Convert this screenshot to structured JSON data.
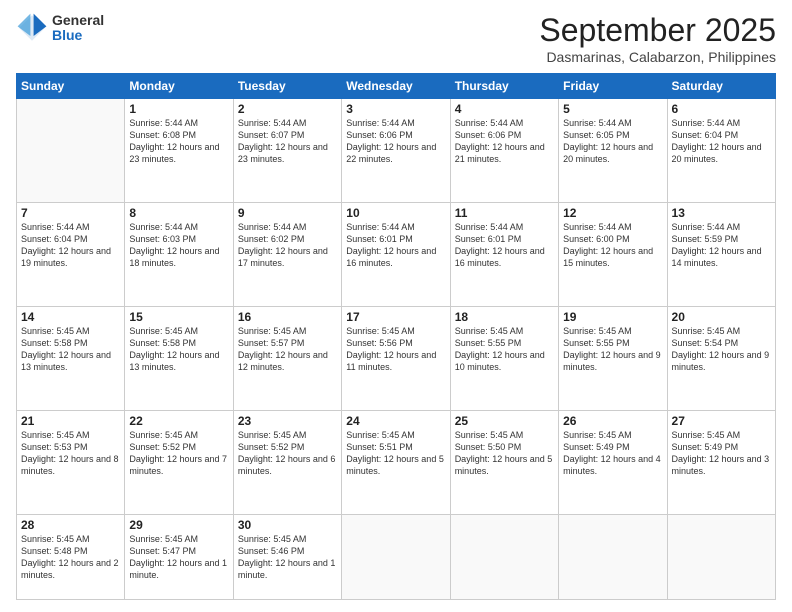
{
  "logo": {
    "general": "General",
    "blue": "Blue"
  },
  "header": {
    "month": "September 2025",
    "location": "Dasmarinas, Calabarzon, Philippines"
  },
  "days_of_week": [
    "Sunday",
    "Monday",
    "Tuesday",
    "Wednesday",
    "Thursday",
    "Friday",
    "Saturday"
  ],
  "weeks": [
    [
      {
        "day": "",
        "info": ""
      },
      {
        "day": "1",
        "info": "Sunrise: 5:44 AM\nSunset: 6:08 PM\nDaylight: 12 hours\nand 23 minutes."
      },
      {
        "day": "2",
        "info": "Sunrise: 5:44 AM\nSunset: 6:07 PM\nDaylight: 12 hours\nand 23 minutes."
      },
      {
        "day": "3",
        "info": "Sunrise: 5:44 AM\nSunset: 6:06 PM\nDaylight: 12 hours\nand 22 minutes."
      },
      {
        "day": "4",
        "info": "Sunrise: 5:44 AM\nSunset: 6:06 PM\nDaylight: 12 hours\nand 21 minutes."
      },
      {
        "day": "5",
        "info": "Sunrise: 5:44 AM\nSunset: 6:05 PM\nDaylight: 12 hours\nand 20 minutes."
      },
      {
        "day": "6",
        "info": "Sunrise: 5:44 AM\nSunset: 6:04 PM\nDaylight: 12 hours\nand 20 minutes."
      }
    ],
    [
      {
        "day": "7",
        "info": "Sunrise: 5:44 AM\nSunset: 6:04 PM\nDaylight: 12 hours\nand 19 minutes."
      },
      {
        "day": "8",
        "info": "Sunrise: 5:44 AM\nSunset: 6:03 PM\nDaylight: 12 hours\nand 18 minutes."
      },
      {
        "day": "9",
        "info": "Sunrise: 5:44 AM\nSunset: 6:02 PM\nDaylight: 12 hours\nand 17 minutes."
      },
      {
        "day": "10",
        "info": "Sunrise: 5:44 AM\nSunset: 6:01 PM\nDaylight: 12 hours\nand 16 minutes."
      },
      {
        "day": "11",
        "info": "Sunrise: 5:44 AM\nSunset: 6:01 PM\nDaylight: 12 hours\nand 16 minutes."
      },
      {
        "day": "12",
        "info": "Sunrise: 5:44 AM\nSunset: 6:00 PM\nDaylight: 12 hours\nand 15 minutes."
      },
      {
        "day": "13",
        "info": "Sunrise: 5:44 AM\nSunset: 5:59 PM\nDaylight: 12 hours\nand 14 minutes."
      }
    ],
    [
      {
        "day": "14",
        "info": "Sunrise: 5:45 AM\nSunset: 5:58 PM\nDaylight: 12 hours\nand 13 minutes."
      },
      {
        "day": "15",
        "info": "Sunrise: 5:45 AM\nSunset: 5:58 PM\nDaylight: 12 hours\nand 13 minutes."
      },
      {
        "day": "16",
        "info": "Sunrise: 5:45 AM\nSunset: 5:57 PM\nDaylight: 12 hours\nand 12 minutes."
      },
      {
        "day": "17",
        "info": "Sunrise: 5:45 AM\nSunset: 5:56 PM\nDaylight: 12 hours\nand 11 minutes."
      },
      {
        "day": "18",
        "info": "Sunrise: 5:45 AM\nSunset: 5:55 PM\nDaylight: 12 hours\nand 10 minutes."
      },
      {
        "day": "19",
        "info": "Sunrise: 5:45 AM\nSunset: 5:55 PM\nDaylight: 12 hours\nand 9 minutes."
      },
      {
        "day": "20",
        "info": "Sunrise: 5:45 AM\nSunset: 5:54 PM\nDaylight: 12 hours\nand 9 minutes."
      }
    ],
    [
      {
        "day": "21",
        "info": "Sunrise: 5:45 AM\nSunset: 5:53 PM\nDaylight: 12 hours\nand 8 minutes."
      },
      {
        "day": "22",
        "info": "Sunrise: 5:45 AM\nSunset: 5:52 PM\nDaylight: 12 hours\nand 7 minutes."
      },
      {
        "day": "23",
        "info": "Sunrise: 5:45 AM\nSunset: 5:52 PM\nDaylight: 12 hours\nand 6 minutes."
      },
      {
        "day": "24",
        "info": "Sunrise: 5:45 AM\nSunset: 5:51 PM\nDaylight: 12 hours\nand 5 minutes."
      },
      {
        "day": "25",
        "info": "Sunrise: 5:45 AM\nSunset: 5:50 PM\nDaylight: 12 hours\nand 5 minutes."
      },
      {
        "day": "26",
        "info": "Sunrise: 5:45 AM\nSunset: 5:49 PM\nDaylight: 12 hours\nand 4 minutes."
      },
      {
        "day": "27",
        "info": "Sunrise: 5:45 AM\nSunset: 5:49 PM\nDaylight: 12 hours\nand 3 minutes."
      }
    ],
    [
      {
        "day": "28",
        "info": "Sunrise: 5:45 AM\nSunset: 5:48 PM\nDaylight: 12 hours\nand 2 minutes."
      },
      {
        "day": "29",
        "info": "Sunrise: 5:45 AM\nSunset: 5:47 PM\nDaylight: 12 hours\nand 1 minute."
      },
      {
        "day": "30",
        "info": "Sunrise: 5:45 AM\nSunset: 5:46 PM\nDaylight: 12 hours\nand 1 minute."
      },
      {
        "day": "",
        "info": ""
      },
      {
        "day": "",
        "info": ""
      },
      {
        "day": "",
        "info": ""
      },
      {
        "day": "",
        "info": ""
      }
    ]
  ]
}
